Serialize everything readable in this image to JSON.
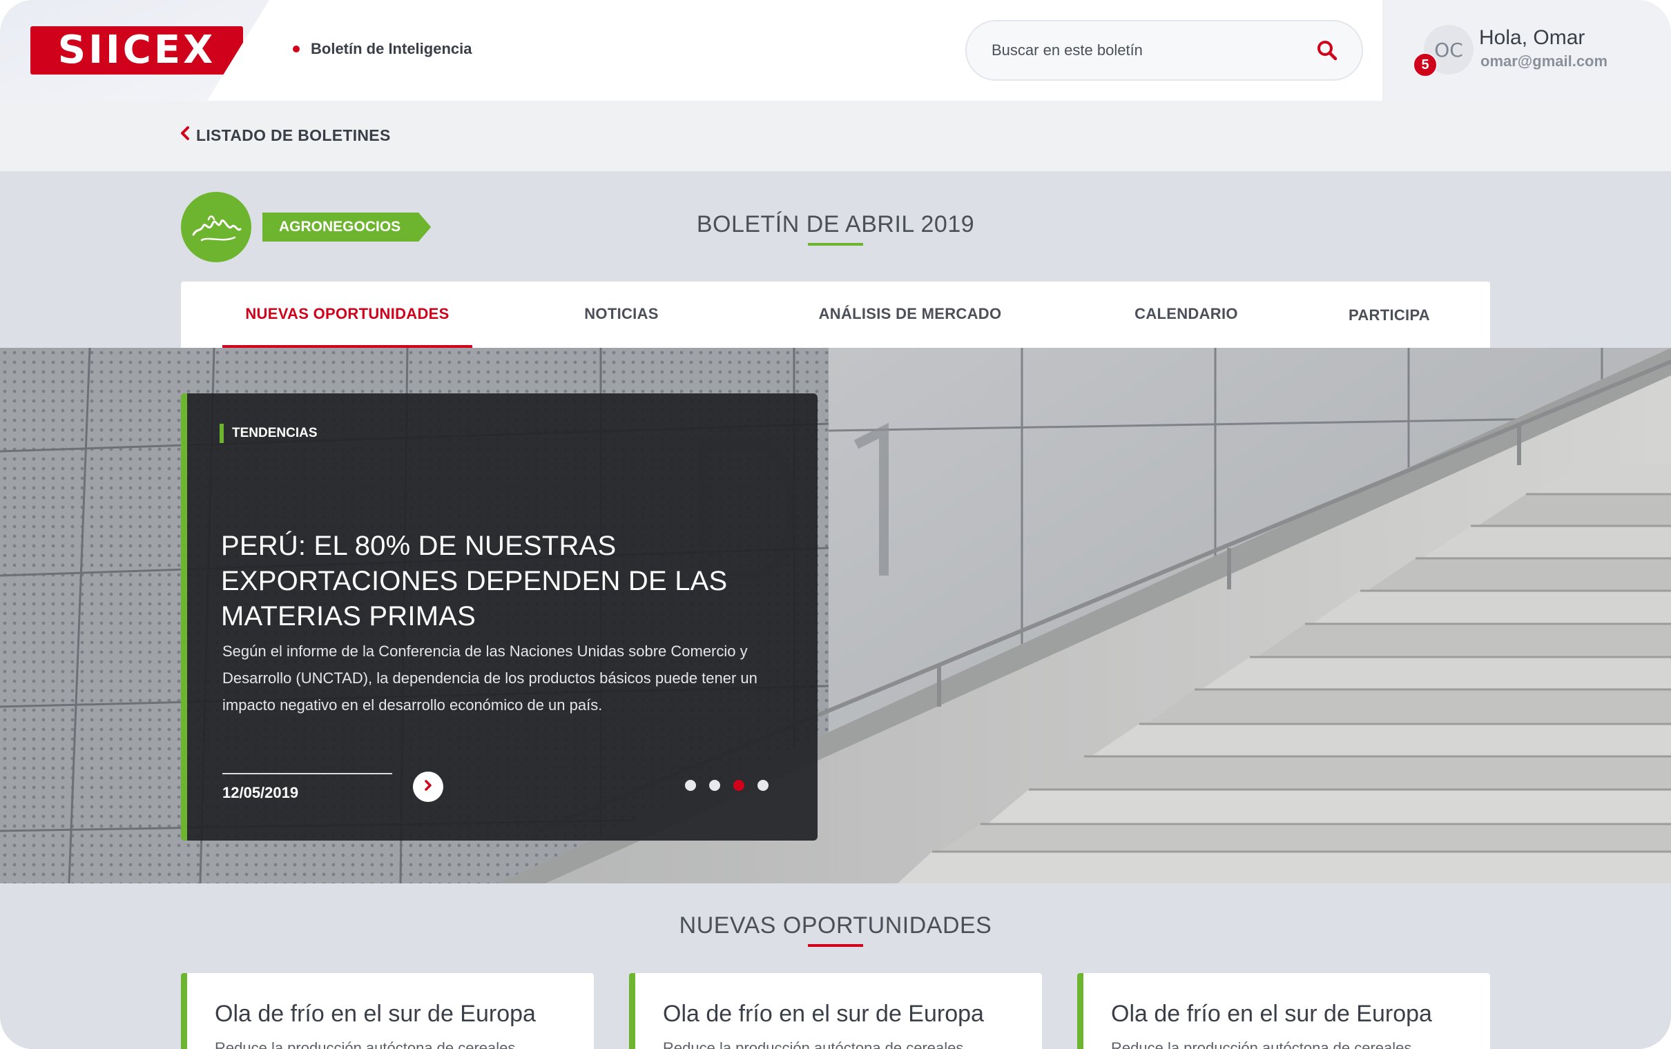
{
  "header": {
    "logo_text": "SIICEX",
    "section_label": "Boletín de Inteligencia",
    "search_placeholder": "Buscar en este boletín",
    "user": {
      "initials": "OC",
      "notifications": "5",
      "greeting": "Hola, Omar",
      "email": "omar@gmail.com"
    }
  },
  "breadcrumb": {
    "back_label": "LISTADO DE BOLETINES"
  },
  "bulletin": {
    "category": "AGRONEGOCIOS",
    "title": "BOLETÍN DE ABRIL 2019"
  },
  "tabs": [
    {
      "label": "NUEVAS OPORTUNIDADES",
      "active": true
    },
    {
      "label": "NOTICIAS",
      "active": false
    },
    {
      "label": "ANÁLISIS DE MERCADO",
      "active": false
    },
    {
      "label": "CALENDARIO",
      "active": false
    },
    {
      "label": "PARTICIPA",
      "active": false
    }
  ],
  "hero": {
    "tag": "TENDENCIAS",
    "title": "PERÚ: EL 80% DE NUESTRAS EXPORTACIONES DEPENDEN DE LAS MATERIAS PRIMAS",
    "text": "Según el informe de la Conferencia de las Naciones Unidas sobre Comercio y Desarrollo (UNCTAD), la dependencia de los productos básicos puede tener un impacto negativo en el desarrollo económico de un país.",
    "date": "12/05/2019",
    "slides": 4,
    "active_slide": 3
  },
  "opportunities": {
    "title": "NUEVAS OPORTUNIDADES",
    "cards": [
      {
        "title": "Ola de frío en el sur de Europa",
        "text": "Reduce la producción autóctona de cereales"
      },
      {
        "title": "Ola de frío en el sur de Europa",
        "text": "Reduce la producción autóctona de cereales"
      },
      {
        "title": "Ola de frío en el sur de Europa",
        "text": "Reduce la producción autóctona de cereales"
      }
    ]
  },
  "colors": {
    "brand_red": "#d0021b",
    "accent_green": "#6eb52f",
    "text_dark": "#3a3f47",
    "page_bg": "#dcdfe6"
  },
  "icons": {
    "search": "search-icon",
    "back": "chevron-left-icon",
    "next": "chevron-right-icon",
    "category": "agro-mountain-icon"
  }
}
